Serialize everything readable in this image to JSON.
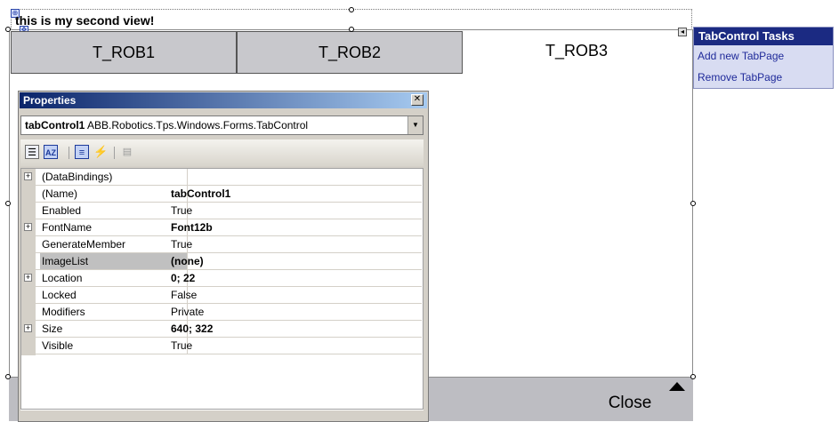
{
  "designer": {
    "header_title": "this is my second view!",
    "tabs": [
      "T_ROB1",
      "T_ROB2",
      "T_ROB3"
    ],
    "close_label": "Close"
  },
  "tasks_panel": {
    "title": "TabControl Tasks",
    "links": [
      "Add new TabPage",
      "Remove TabPage"
    ]
  },
  "properties": {
    "title": "Properties",
    "object_name": "tabControl1",
    "object_type": "ABB.Robotics.Tps.Windows.Forms.TabControl",
    "rows": [
      {
        "name": "(DataBindings)",
        "value": "",
        "expandable": true,
        "bold": false
      },
      {
        "name": "(Name)",
        "value": "tabControl1",
        "expandable": false,
        "bold": true
      },
      {
        "name": "Enabled",
        "value": "True",
        "expandable": false,
        "bold": false
      },
      {
        "name": "FontName",
        "value": "Font12b",
        "expandable": true,
        "bold": true
      },
      {
        "name": "GenerateMember",
        "value": "True",
        "expandable": false,
        "bold": false
      },
      {
        "name": "ImageList",
        "value": "(none)",
        "expandable": false,
        "bold": true
      },
      {
        "name": "Location",
        "value": "0; 22",
        "expandable": true,
        "bold": true
      },
      {
        "name": "Locked",
        "value": "False",
        "expandable": false,
        "bold": false
      },
      {
        "name": "Modifiers",
        "value": "Private",
        "expandable": false,
        "bold": false
      },
      {
        "name": "Size",
        "value": "640; 322",
        "expandable": true,
        "bold": true
      },
      {
        "name": "Visible",
        "value": "True",
        "expandable": false,
        "bold": false
      }
    ],
    "selected_row": "ImageList",
    "toolbar_icons": [
      "categorized-icon",
      "alphabetical-icon",
      "properties-icon",
      "events-icon",
      "property-pages-icon"
    ]
  },
  "colors": {
    "tab_gray": "#c8c8cc",
    "tasks_header": "#1b2a82",
    "link_blue": "#1f2a9a",
    "title_gradient_start": "#0a246a"
  }
}
